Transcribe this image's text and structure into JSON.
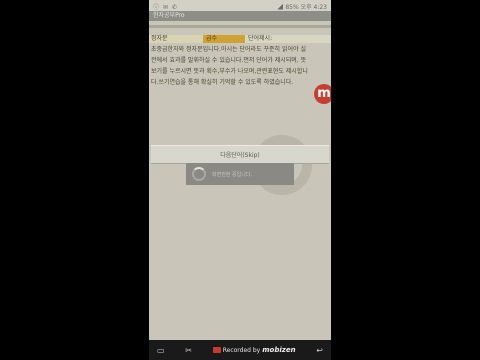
{
  "status_bar": {
    "left_icons": "ⓘ ✉ ✆",
    "right_text": "85% 오후 4:23"
  },
  "app": {
    "title": "한자공부Pro"
  },
  "header": {
    "col1": "정자문",
    "col2": "급수",
    "col3": "단어제시:"
  },
  "description": "초중급한자와 정자문입니다.아시는 단어라도 꾸준히 읽어야 실전에서 효과를 발휘하실 수 있습니다.먼저 단어가 제시되며, 뜻보기를 누르시면 뜻과 획수,부수가 나오며,관련표현도 제시합니다.쓰기연습을 통해 확실히 기억할 수 있도록 하였습니다.",
  "badge": {
    "letter": "m"
  },
  "buttons": {
    "skip": "다음단어(Skip)"
  },
  "loading": {
    "text": "화면전환 중입니다."
  },
  "navbar": {
    "recorder_prefix": "Recorded by",
    "recorder_brand": "mobizen"
  },
  "colors": {
    "background": "#c9c6b9",
    "accent": "#cfa233",
    "badge": "#c73d30"
  }
}
